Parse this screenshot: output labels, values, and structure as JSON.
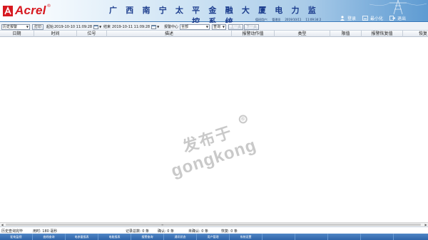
{
  "header": {
    "logo_text": "Acrel",
    "logo_reg": "®",
    "title": "广 西 南 宁 太 平 金 融 大 厦 电 力 监 控 系 统",
    "user_label": "值班用户:",
    "user_name": "管理员",
    "date": "2019/10/11",
    "time": "11:09:34 2",
    "buttons": [
      {
        "label": "登录",
        "icon": "user-icon"
      },
      {
        "label": "最小化",
        "icon": "minimize-icon"
      },
      {
        "label": "退出",
        "icon": "exit-icon"
      }
    ]
  },
  "toolbar": {
    "view_select": "历史报警",
    "print_button": "打印",
    "start_label": "起始",
    "start_value": "2019-10-10 11:09:28",
    "end_label": "结束",
    "end_value": "2019-10-11 11:09:28",
    "center_label": "报警中心",
    "center_select": "全部",
    "query_button": "查询",
    "prev_button": "上一页",
    "next_button": "下一页"
  },
  "table": {
    "columns": [
      "日期",
      "时间",
      "位号",
      "描述",
      "报警动作值",
      "类型",
      "限值",
      "报警恢复值",
      "恢复"
    ],
    "rows": []
  },
  "watermark": {
    "cn": "发布于",
    "en": "gongkong",
    "reg": "®"
  },
  "status": {
    "message": "历史查询完毕",
    "elapsed": "用时: 180 毫秒",
    "total": "记录总数: 0 条",
    "confirmed": "确认: 0 条",
    "unconfirmed": "未确认: 0 条",
    "restored": "恢复: 0 条"
  },
  "nav": {
    "items": [
      "配电监视",
      "曲线查询",
      "电参量报表",
      "电能报表",
      "报警查询",
      "通讯状态",
      "用户管理",
      "系统设置",
      "",
      "",
      "",
      "",
      ""
    ]
  },
  "colors": {
    "brand_red": "#d71920",
    "title_blue": "#1a3b8c",
    "nav_blue": "#2f64a8"
  }
}
